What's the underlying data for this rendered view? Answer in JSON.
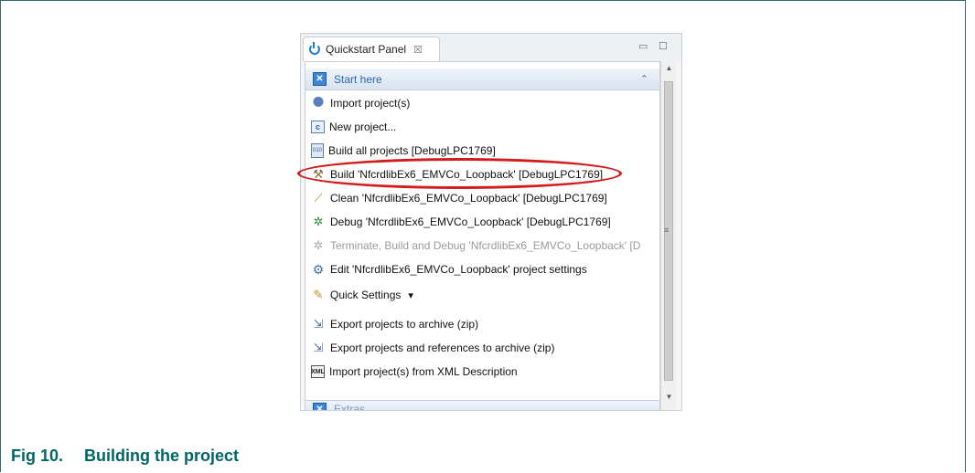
{
  "panel": {
    "tab_title": "Quickstart Panel",
    "tab_close": "☒",
    "minimize": "▭",
    "maximize": "☐"
  },
  "sections": {
    "start_here": {
      "title": "Start here",
      "toggle": "⌃"
    },
    "extras": {
      "title": "Extras",
      "toggle": "⌄"
    }
  },
  "items": [
    {
      "icon": "import-project-icon",
      "label": "Import project(s)"
    },
    {
      "icon": "new-project-icon",
      "label": "New project..."
    },
    {
      "icon": "build-all-icon",
      "label": "Build all projects [DebugLPC1769]"
    },
    {
      "icon": "build-hammer-icon",
      "label": "Build 'NfcrdlibEx6_EMVCo_Loopback' [DebugLPC1769]"
    },
    {
      "icon": "clean-broom-icon",
      "label": "Clean 'NfcrdlibEx6_EMVCo_Loopback' [DebugLPC1769]"
    },
    {
      "icon": "debug-bug-icon",
      "label": "Debug 'NfcrdlibEx6_EMVCo_Loopback' [DebugLPC1769]"
    },
    {
      "icon": "terminate-build-debug-icon",
      "label": "Terminate, Build and Debug 'NfcrdlibEx6_EMVCo_Loopback' [D"
    },
    {
      "icon": "project-settings-icon",
      "label": "Edit 'NfcrdlibEx6_EMVCo_Loopback' project settings"
    },
    {
      "icon": "quick-settings-icon",
      "label": "Quick Settings",
      "dropdown": "▾"
    },
    {
      "icon": "export-archive-icon",
      "label": "Export projects to archive (zip)"
    },
    {
      "icon": "export-references-icon",
      "label": "Export projects and references to archive (zip)"
    },
    {
      "icon": "import-xml-icon",
      "label": "Import project(s) from XML Description"
    }
  ],
  "caption": {
    "number": "Fig 10.",
    "text": "Building the project"
  },
  "colors": {
    "caption": "#006666",
    "highlight": "#d21b1b",
    "section_title": "#2a66b0"
  }
}
